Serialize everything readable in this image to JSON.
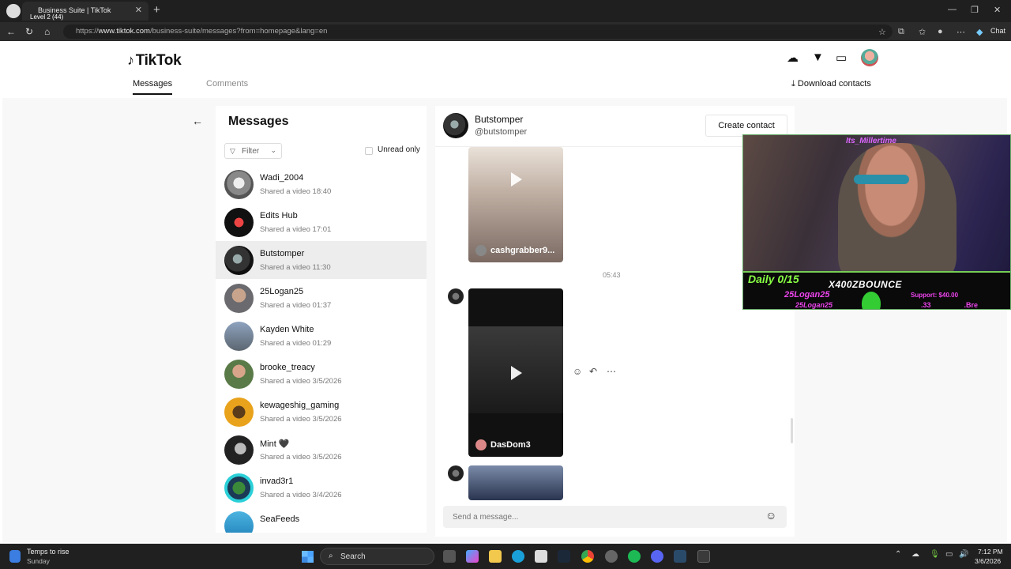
{
  "browser": {
    "tab_title": "Business Suite | TikTok",
    "overlay_line1": "Level 2 (44)",
    "url_prefix": "https://",
    "url_host": "www.tiktok.com",
    "url_path": "/business-suite/messages?from=homepage&lang=en",
    "chat_label": "Chat"
  },
  "header": {
    "brand": "TikTok",
    "tabs": [
      {
        "label": "Messages"
      },
      {
        "label": "Comments"
      }
    ],
    "download_label": "Download contacts"
  },
  "messages_panel": {
    "title": "Messages",
    "filter_label": "Filter",
    "unread_label": "Unread only",
    "conversations": [
      {
        "name": "Wadi_2004",
        "sub": "Shared a video 18:40"
      },
      {
        "name": "Edits Hub",
        "sub": "Shared a video 17:01"
      },
      {
        "name": "Butstomper",
        "sub": "Shared a video 11:30"
      },
      {
        "name": "25Logan25",
        "sub": "Shared a video 01:37"
      },
      {
        "name": "Kayden White",
        "sub": "Shared a video 01:29"
      },
      {
        "name": "brooke_treacy",
        "sub": "Shared a video 3/5/2026"
      },
      {
        "name": "kewageshig_gaming",
        "sub": "Shared a video 3/5/2026"
      },
      {
        "name": "Mint 🖤",
        "sub": "Shared a video 3/5/2026"
      },
      {
        "name": "invad3r1",
        "sub": "Shared a video 3/4/2026"
      },
      {
        "name": "SeaFeeds",
        "sub": ""
      }
    ]
  },
  "chat": {
    "name": "Butstomper",
    "handle": "@butstomper",
    "create_contact": "Create contact",
    "timestamp": "05:43",
    "videos": [
      {
        "user": "cashgrabber9..."
      },
      {
        "user": "DasDom3"
      }
    ],
    "input_placeholder": "Send a message..."
  },
  "webcam": {
    "top_text": "Its_Millertime",
    "daily": "Daily 0/15",
    "streamer": "X400ZBOUNCE",
    "line1": "25Logan25",
    "line2": "25Logan25",
    "amount": ".33",
    "support": "Support: $40.00",
    "suffix": ".Bre"
  },
  "taskbar": {
    "weather_temp": "Temps to rise",
    "weather_day": "Sunday",
    "search_label": "Search",
    "time": "7:12 PM",
    "date": "3/6/2026"
  },
  "icons": [
    "upload-cloud-icon",
    "send-filter-icon",
    "message-icon",
    "download-icon",
    "back-arrow-icon",
    "funnel-icon",
    "chevron-down-icon",
    "play-icon",
    "react-icon",
    "reply-icon",
    "more-icon",
    "emoji-icon",
    "search-icon",
    "windows-start-icon"
  ]
}
